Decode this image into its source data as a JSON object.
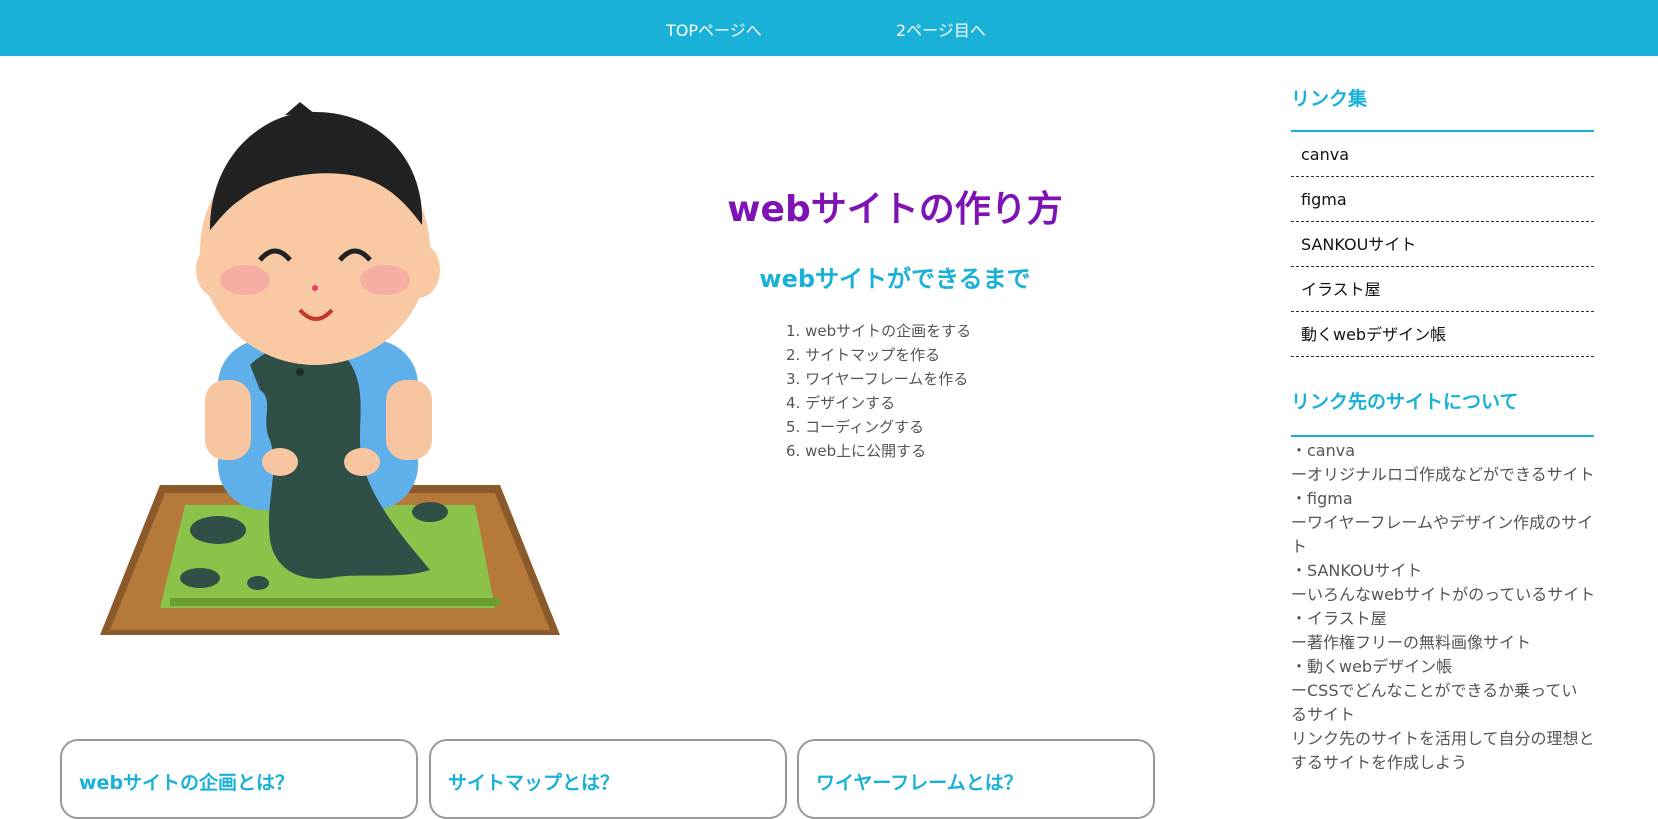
{
  "nav": {
    "top_link": "TOPページへ",
    "page2_link": "2ページ目へ"
  },
  "hero": {
    "title": "webサイトの作り方",
    "subtitle": "webサイトができるまで",
    "steps": [
      "1. webサイトの企画をする",
      "2. サイトマップを作る",
      "3. ワイヤーフレームを作る",
      "4. デザインする",
      "5. コーディングする",
      "6. web上に公開する"
    ]
  },
  "sidebar": {
    "links_title": "リンク集",
    "links": [
      "canva",
      "figma",
      "SANKOUサイト",
      "イラスト屋",
      "動くwebデザイン帳"
    ],
    "about_title": "リンク先のサイトについて",
    "about_lines": [
      "・canva",
      "ーオリジナルロゴ作成などができるサイト",
      "・figma",
      "ーワイヤーフレームやデザイン作成のサイ",
      "ト",
      "・SANKOUサイト",
      "ーいろんなwebサイトがのっているサイト",
      "・イラスト屋",
      "ー著作権フリーの無料画像サイト",
      "・動くwebデザイン帳",
      "ーCSSでどんなことができるか乗ってい",
      "るサイト",
      "リンク先のサイトを活用して自分の理想と",
      "するサイトを作成しよう"
    ]
  },
  "cards": [
    {
      "title": "webサイトの企画とは？"
    },
    {
      "title": "サイトマップとは？"
    },
    {
      "title": "ワイヤーフレームとは？"
    }
  ],
  "colors": {
    "accent": "#19b1d8",
    "title_purple": "#7d13b4"
  }
}
